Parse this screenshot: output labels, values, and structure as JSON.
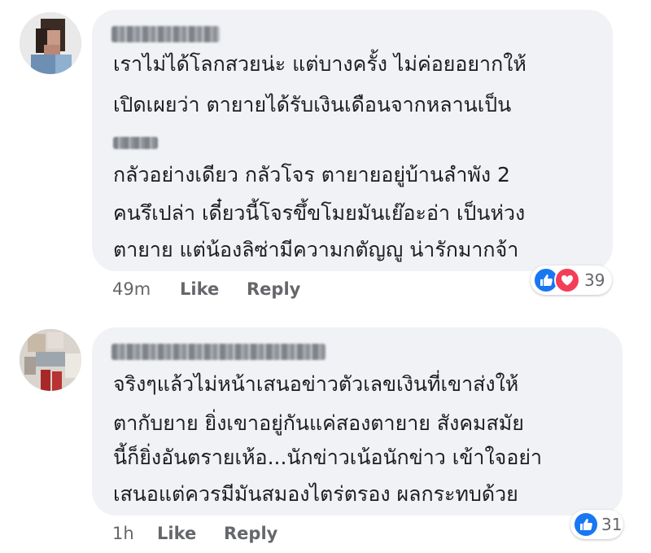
{
  "comments": [
    {
      "time": "49m",
      "like_label": "Like",
      "reply_label": "Reply",
      "lines": [
        "เราไม่ได้โลกสวยน่ะ แต่บางครั้ง ไม่ค่อยอยากให้",
        "เปิดเผยว่า ตายายได้รับเงินเดือนจากหลานเป็น",
        "กลัวอย่างเดียว กลัวโจร ตายายอยู่บ้านลำพัง 2",
        "คนรึเปล่า เดี๋ยวนี้โจรขึ้ขโมยมันเย๊อะอ่า เป็นห่วง",
        "ตายาย แต่น้องลิซ่ามีความกตัญญู น่ารักมากจ้า"
      ],
      "reactions": {
        "icons": [
          "like-icon",
          "love-icon"
        ],
        "count": "39"
      }
    },
    {
      "time": "1h",
      "like_label": "Like",
      "reply_label": "Reply",
      "lines": [
        "จริงๆแล้วไม่หน้าเสนอข่าวตัวเลขเงินที่เขาส่งให้",
        "ตากับยาย ยิ่งเขาอยู่กันแค่สองตายาย สังคมสมัย",
        "นี้ก็ยิ่งอันตรายเห้อ...นักข่าวเน้อนักข่าว เข้าใจอย่า",
        "เสนอแต่ควรมีมันสมองไตร่ตรอง ผลกระทบด้วย"
      ],
      "reactions": {
        "icons": [
          "like-icon"
        ],
        "count": "31"
      }
    }
  ],
  "colors": {
    "bubble": "#f0f2f5",
    "like": "#1877f2",
    "love": "#f33e58",
    "meta": "#65676b"
  }
}
